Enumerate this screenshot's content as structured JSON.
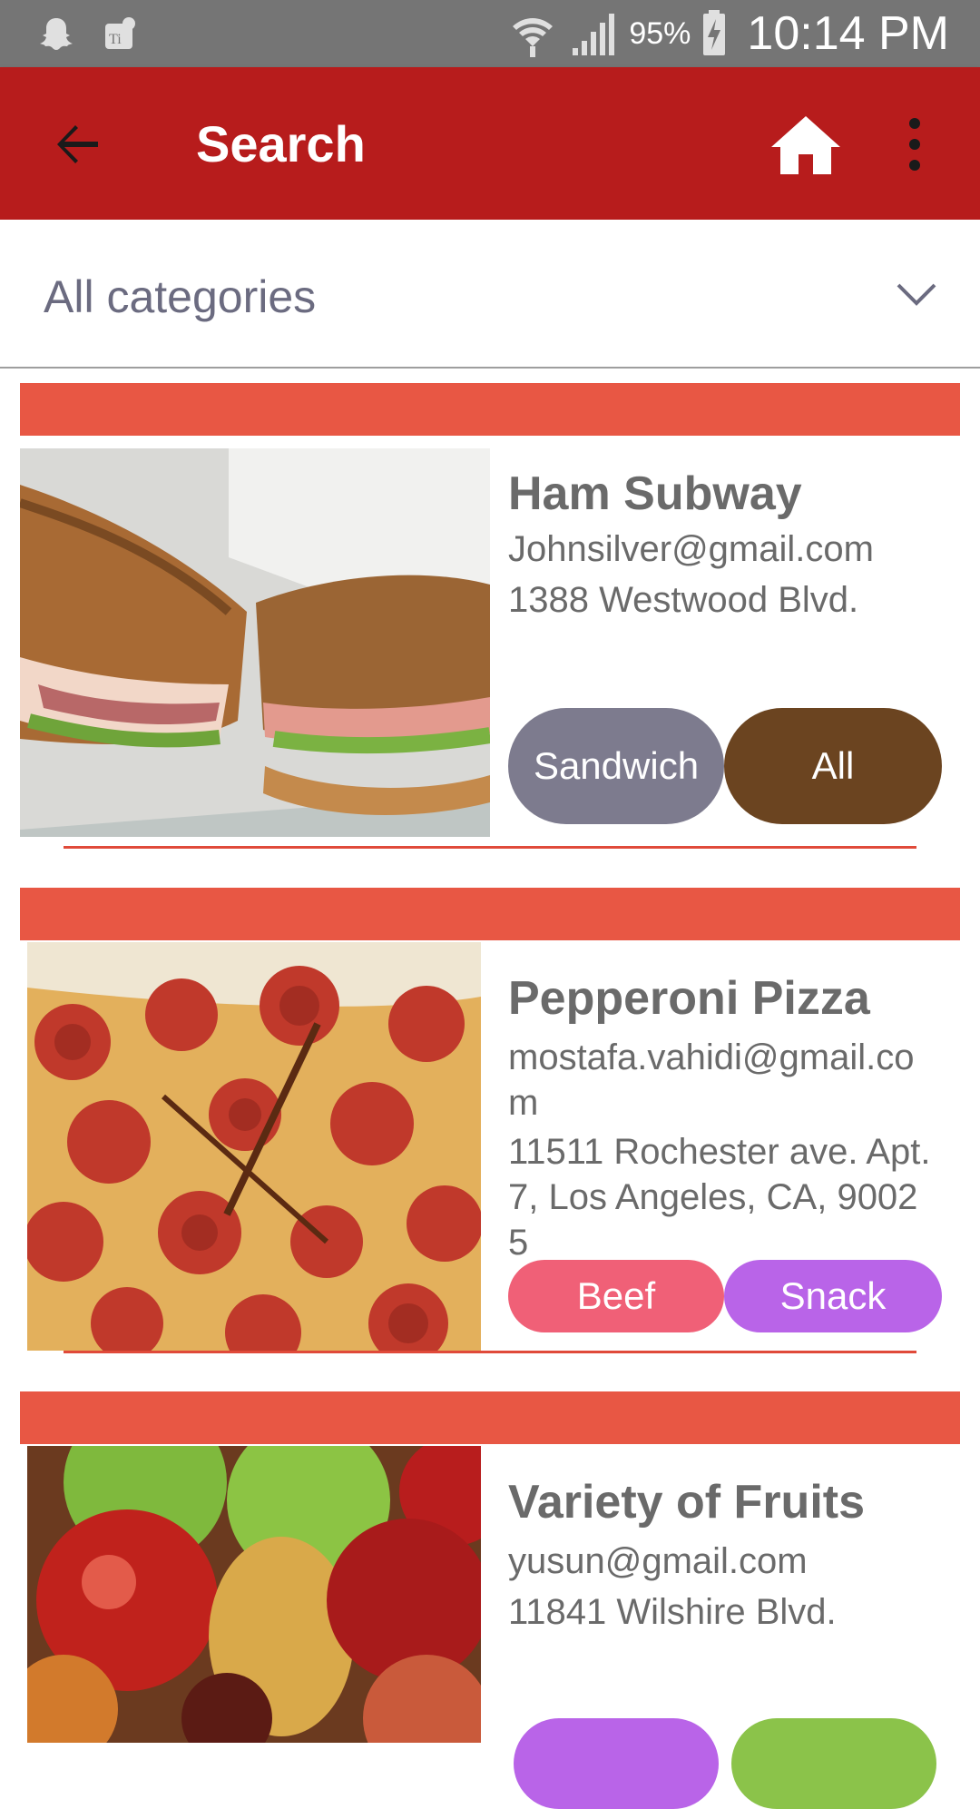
{
  "status_bar": {
    "battery": "95%",
    "time": "10:14 PM"
  },
  "app_bar": {
    "title": "Search"
  },
  "category_filter": {
    "selected": "All categories"
  },
  "colors": {
    "app_bar": "#b71c1c",
    "card_header": "#e85744",
    "divider": "#e04a3a"
  },
  "items": [
    {
      "title": "Ham Subway",
      "email": "Johnsilver@gmail.com",
      "address": "1388 Westwood Blvd.",
      "tags": [
        {
          "label": "Sandwich",
          "color": "#7d7b8e"
        },
        {
          "label": "All",
          "color": "#6b4420"
        }
      ]
    },
    {
      "title": "Pepperoni Pizza",
      "email": "mostafa.vahidi@gmail.com",
      "address": "11511 Rochester ave. Apt. 7, Los Angeles, CA, 90025",
      "tags": [
        {
          "label": "Beef",
          "color": "#f06077"
        },
        {
          "label": "Snack",
          "color": "#b964e8"
        }
      ]
    },
    {
      "title": "Variety of Fruits",
      "email": "yusun@gmail.com",
      "address": "11841 Wilshire Blvd.",
      "tags": [
        {
          "label": "",
          "color": "#b964e8"
        },
        {
          "label": "",
          "color": "#8bc34a"
        }
      ]
    }
  ]
}
